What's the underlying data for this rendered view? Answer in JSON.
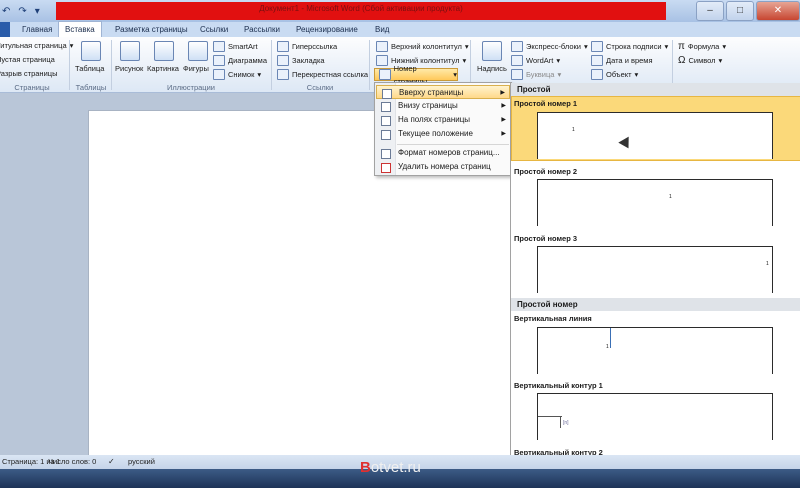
{
  "window": {
    "title": "Документ1 - Microsoft Word (Сбой активации продукта)"
  },
  "tabs": [
    "Главная",
    "Вставка",
    "Разметка страницы",
    "Ссылки",
    "Рассылки",
    "Рецензирование",
    "Вид"
  ],
  "ribbon": {
    "pages": {
      "items": [
        "Титульная страница",
        "Пустая страница",
        "Разрыв страницы"
      ],
      "label": "Страницы"
    },
    "tables": {
      "button": "Таблица",
      "label": "Таблицы"
    },
    "illustrations": {
      "picture": "Рисунок",
      "clipart": "Картинка",
      "shapes": "Фигуры",
      "smartart": "SmartArt",
      "chart": "Диаграмма",
      "screenshot": "Снимок",
      "label": "Иллюстрации"
    },
    "links": {
      "hyperlink": "Гиперссылка",
      "bookmark": "Закладка",
      "crossref": "Перекрестная ссылка",
      "label": "Ссылки"
    },
    "headerfooter": {
      "header": "Верхний колонтитул",
      "footer": "Нижний колонтитул",
      "pagenumber": "Номер страницы"
    },
    "text": {
      "textbox": "Надпись",
      "quickparts": "Экспресс-блоки",
      "wordart": "WordArt",
      "dropcap": "Буквица",
      "signature": "Строка подписи",
      "datetime": "Дата и время",
      "object": "Объект"
    },
    "symbols": {
      "formula": "Формула",
      "symbol": "Символ"
    }
  },
  "menu": {
    "items": [
      "Вверху страницы",
      "Внизу страницы",
      "На полях страницы",
      "Текущее положение",
      "Формат номеров страниц...",
      "Удалить номера страниц"
    ],
    "active_index": 0
  },
  "gallery": {
    "section1": "Простой",
    "items1": [
      {
        "title": "Простой номер 1",
        "num": "1"
      },
      {
        "title": "Простой номер 2",
        "num": "1"
      },
      {
        "title": "Простой номер 3",
        "num": "1"
      }
    ],
    "section2": "Простой номер",
    "items2": [
      {
        "title": "Вертикальная линия",
        "num": "1"
      },
      {
        "title": "Вертикальный контур 1",
        "num": "[n]"
      },
      {
        "title": "Вертикальный контур 2",
        "num": ""
      }
    ]
  },
  "status": {
    "page": "Страница: 1 из 1",
    "words": "Число слов: 0",
    "language": "русский"
  },
  "watermark": {
    "first": "B",
    "rest": "otvet.ru"
  },
  "colors": {
    "accent": "#2a5caa",
    "highlight": "#fbd97a",
    "titlebar_red": "#e11010"
  }
}
